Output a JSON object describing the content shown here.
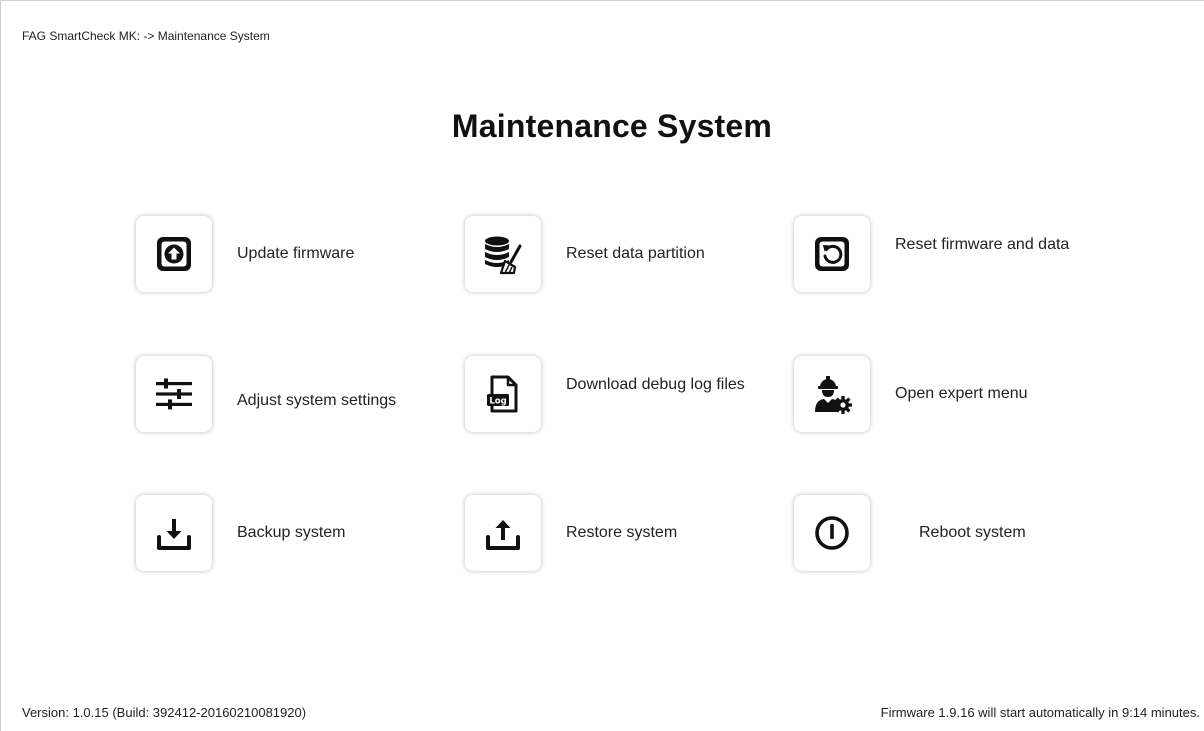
{
  "breadcrumb": "FAG SmartCheck MK: -> Maintenance System",
  "title": "Maintenance System",
  "tiles": [
    {
      "label": "Update firmware",
      "icon": "upload-circle-icon"
    },
    {
      "label": "Reset data partition",
      "icon": "database-broom-icon"
    },
    {
      "label": "Reset firmware and data",
      "icon": "reset-arrow-icon"
    },
    {
      "label": "Adjust  system settings",
      "icon": "sliders-icon"
    },
    {
      "label": "Download debug log files",
      "icon": "log-file-icon"
    },
    {
      "label": "Open expert menu",
      "icon": "expert-worker-gear-icon"
    },
    {
      "label": "Backup system",
      "icon": "download-tray-icon"
    },
    {
      "label": "Restore system",
      "icon": "upload-tray-icon"
    },
    {
      "label": "Reboot system",
      "icon": "power-icon"
    }
  ],
  "footer": {
    "version": "Version: 1.0.15 (Build: 392412-20160210081920)",
    "status": "Firmware 1.9.16 will start automatically in 9:14 minutes."
  }
}
